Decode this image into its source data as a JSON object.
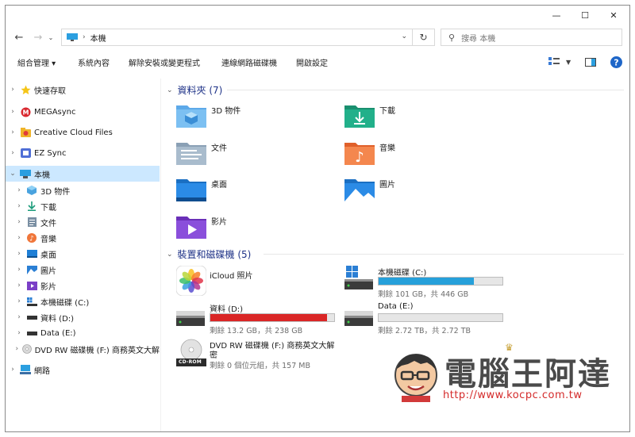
{
  "window": {
    "minimize": "—",
    "maximize": "☐",
    "close": "✕"
  },
  "address": {
    "path": "本機",
    "search_placeholder": "搜尋 本機"
  },
  "toolbar": {
    "organize": "組合管理 ▾",
    "system_properties": "系統內容",
    "uninstall": "解除安裝或變更程式",
    "map_drive": "連線網路磁碟機",
    "open_settings": "開啟設定"
  },
  "nav": {
    "quick_access": "快速存取",
    "megasync": "MEGAsync",
    "creative_cloud": "Creative Cloud Files",
    "ez_sync": "EZ Sync",
    "this_pc": "本機",
    "children": [
      "3D 物件",
      "下載",
      "文件",
      "音樂",
      "桌面",
      "圖片",
      "影片",
      "本機磁碟 (C:)",
      "資料 (D:)",
      "Data (E:)",
      "DVD RW 磁碟機 (F:) 商務英文大解"
    ],
    "network": "網路"
  },
  "content": {
    "folders_header": "資料夾 (7)",
    "folders": [
      "3D 物件",
      "下載",
      "文件",
      "音樂",
      "桌面",
      "圖片",
      "影片"
    ],
    "devices_header": "裝置和磁碟機 (5)",
    "icloud": "iCloud 照片",
    "drives": [
      {
        "name": "本機磁碟 (C:)",
        "free": "剩餘 101 GB，共 446 GB",
        "used_fraction": 0.77,
        "color": "#26a0da"
      },
      {
        "name": "資料 (D:)",
        "free": "剩餘 13.2 GB，共 238 GB",
        "used_fraction": 0.94,
        "color": "#da2626"
      },
      {
        "name": "Data (E:)",
        "free": "剩餘 2.72 TB，共 2.72 TB",
        "used_fraction": 0.0,
        "color": "#26a0da"
      }
    ],
    "dvd": {
      "name_line1": "DVD RW 磁碟機 (F:) 商務英文大解",
      "name_line2": "密",
      "free": "剩餘 0 個位元組，共 157 MB",
      "badge": "CD-ROM"
    }
  },
  "watermark": {
    "title": "電腦王阿達",
    "url": "http://www.kocpc.com.tw"
  }
}
